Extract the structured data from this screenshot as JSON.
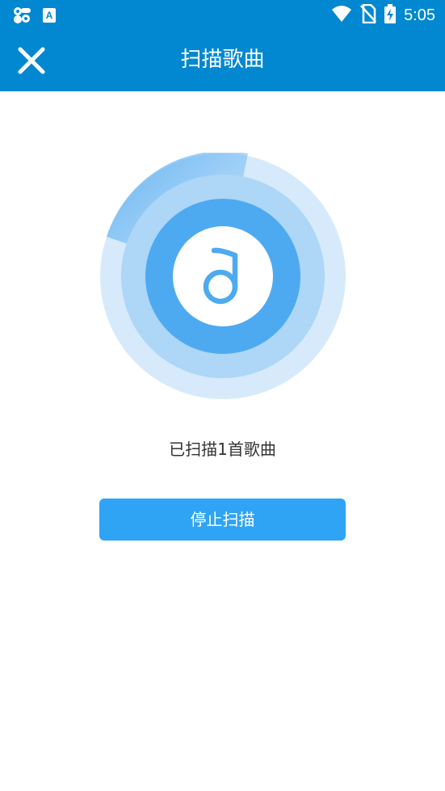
{
  "status_bar": {
    "time": "5:05",
    "left_icons": [
      "app-notification-icon",
      "translate-a-icon"
    ],
    "right_icons": [
      "wifi-icon",
      "no-sim-icon",
      "battery-charging-icon"
    ]
  },
  "app_bar": {
    "title": "扫描歌曲",
    "close_icon": "close-icon",
    "background_color": "#0288d1"
  },
  "scan": {
    "status_text": "已扫描1首歌曲",
    "center_icon": "music-note-icon",
    "ring_colors": [
      "#d6eafb",
      "#add6f7",
      "#4eaaf0",
      "#ffffff"
    ]
  },
  "actions": {
    "stop_label": "停止扫描",
    "stop_color": "#2fa4f5"
  }
}
